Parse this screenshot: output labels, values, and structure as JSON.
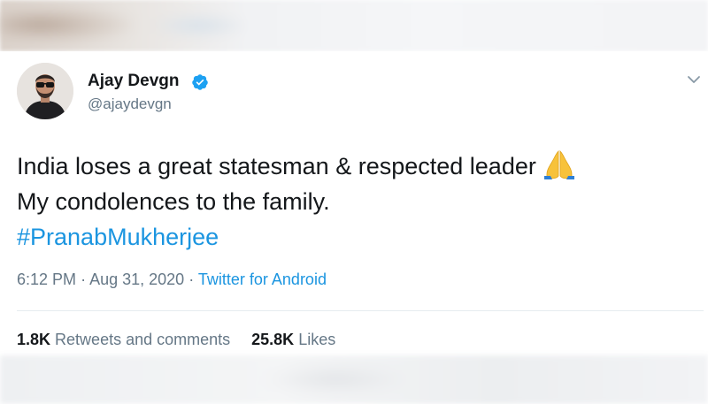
{
  "tweet": {
    "author": {
      "name": "Ajay Devgn",
      "handle": "@ajaydevgn",
      "verified": true
    },
    "text_lines": [
      "India loses a great statesman & respected leader",
      "My condolences to the family."
    ],
    "emoji": "folded-hands",
    "hashtag": "#PranabMukherjee",
    "time": "6:12 PM",
    "separator": "·",
    "date": "Aug 31, 2020",
    "source": "Twitter for Android",
    "stats": {
      "retweets_count": "1.8K",
      "retweets_label": "Retweets and comments",
      "likes_count": "25.8K",
      "likes_label": "Likes"
    }
  },
  "colors": {
    "link": "#1b95e0",
    "secondary_text": "#657786",
    "primary_text": "#14171a",
    "verified_badge": "#1da1f2",
    "divider": "#e6ecf0"
  },
  "icons": {
    "verified": "verified-badge-icon",
    "menu": "chevron-down-icon",
    "emoji": "folded-hands-icon"
  }
}
